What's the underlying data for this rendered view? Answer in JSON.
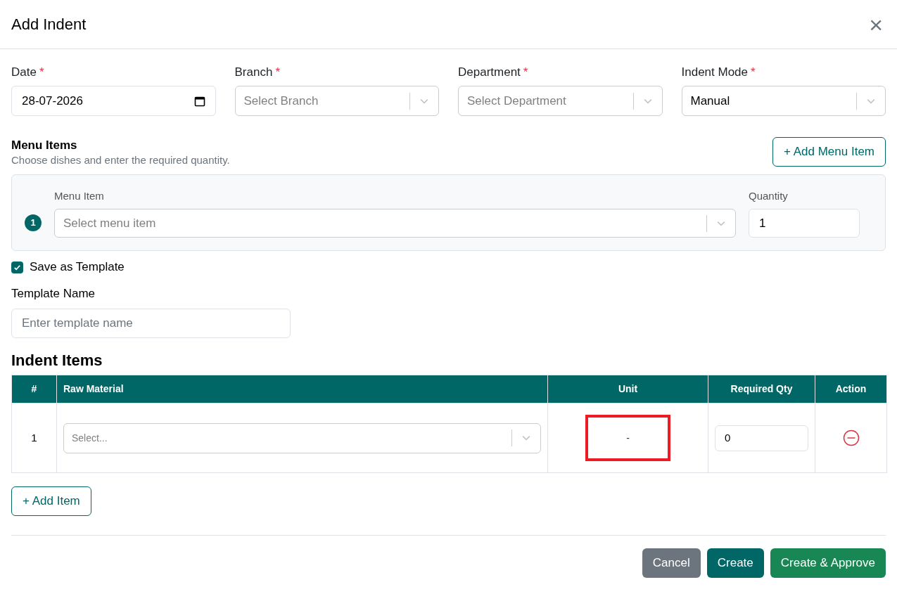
{
  "dialog": {
    "title": "Add Indent",
    "close_icon": "×"
  },
  "fields": [
    {
      "kind": "date",
      "label": "Date",
      "required_mark": "*",
      "value": "28-07-2026"
    },
    {
      "kind": "select",
      "label": "Branch",
      "required_mark": "*",
      "placeholder": "Select Branch"
    },
    {
      "kind": "select",
      "label": "Department",
      "required_mark": "*",
      "placeholder": "Select Department"
    },
    {
      "kind": "select",
      "label": "Indent Mode",
      "required_mark": "*",
      "value": "Manual"
    }
  ],
  "menu_items": {
    "title": "Menu Items",
    "subtitle": "Choose dishes and enter the required quantity.",
    "add_button": "+ Add Menu Item",
    "rows": [
      {
        "number": "1",
        "item_label": "Menu Item",
        "item_placeholder": "Select menu item",
        "quantity_label": "Quantity",
        "quantity": "1"
      }
    ]
  },
  "save_as_template": {
    "label": "Save as Template",
    "checked": true
  },
  "template_name": {
    "label": "Template Name",
    "placeholder": "Enter template name"
  },
  "indent_items": {
    "title": "Indent Items",
    "columns": [
      "#",
      "Raw Material",
      "Unit",
      "Required Qty",
      "Action"
    ],
    "rows": [
      {
        "number": "1",
        "raw_material_placeholder": "Select...",
        "unit": "-",
        "unit_highlighted": true,
        "required_qty": "0"
      }
    ],
    "add_button": "+ Add Item"
  },
  "buttons": [
    {
      "kind": "cancel",
      "label": "Cancel"
    },
    {
      "kind": "create",
      "label": "Create"
    },
    {
      "kind": "approve",
      "label": "Create & Approve"
    }
  ]
}
